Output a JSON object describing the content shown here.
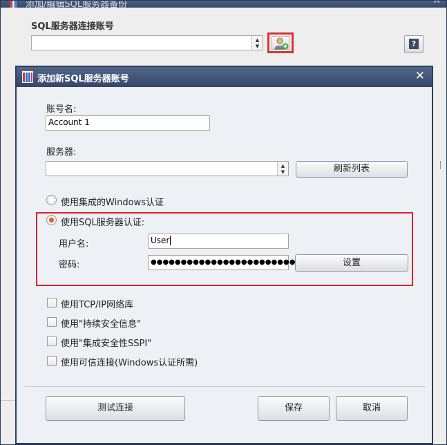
{
  "outer_window": {
    "title": "添加/编辑SQL服务器备份",
    "sql_account_label": "SQL服务器连接账号",
    "sql_account_value": "",
    "help_label": "?"
  },
  "dialog": {
    "title": "添加新SQL服务器账号",
    "close_label": "✕",
    "account_name_label": "账号名:",
    "account_name_value": "Account 1",
    "server_label": "服务器:",
    "server_value": "",
    "refresh_list_label": "刷新列表",
    "auth_windows_label": "使用集成的Windows认证",
    "auth_sql_label": "使用SQL服务器认证:",
    "auth_selected": "sql",
    "username_label": "用户名:",
    "username_value": "User",
    "password_label": "密码:",
    "password_value": "●●●●●●●●●●●●●●●●●●●●●●●●●",
    "settings_label": "设置",
    "options": [
      {
        "label": "使用TCP/IP网络库",
        "checked": false
      },
      {
        "label": "使用\"持续安全信息\"",
        "checked": false
      },
      {
        "label": "使用\"集成安全性SSPI\"",
        "checked": false
      },
      {
        "label": "使用可信连接(Windows认证所需)",
        "checked": false
      }
    ],
    "test_connection_label": "测试连接",
    "save_label": "保存",
    "cancel_label": "取消"
  },
  "colors": {
    "titlebar": "#3b4e72",
    "highlight_red": "#d8232a",
    "radio_selected": "#e35a2e"
  },
  "icons": [
    "app-icon",
    "add-user-icon",
    "help-icon",
    "close-icon",
    "spinner-icon"
  ]
}
